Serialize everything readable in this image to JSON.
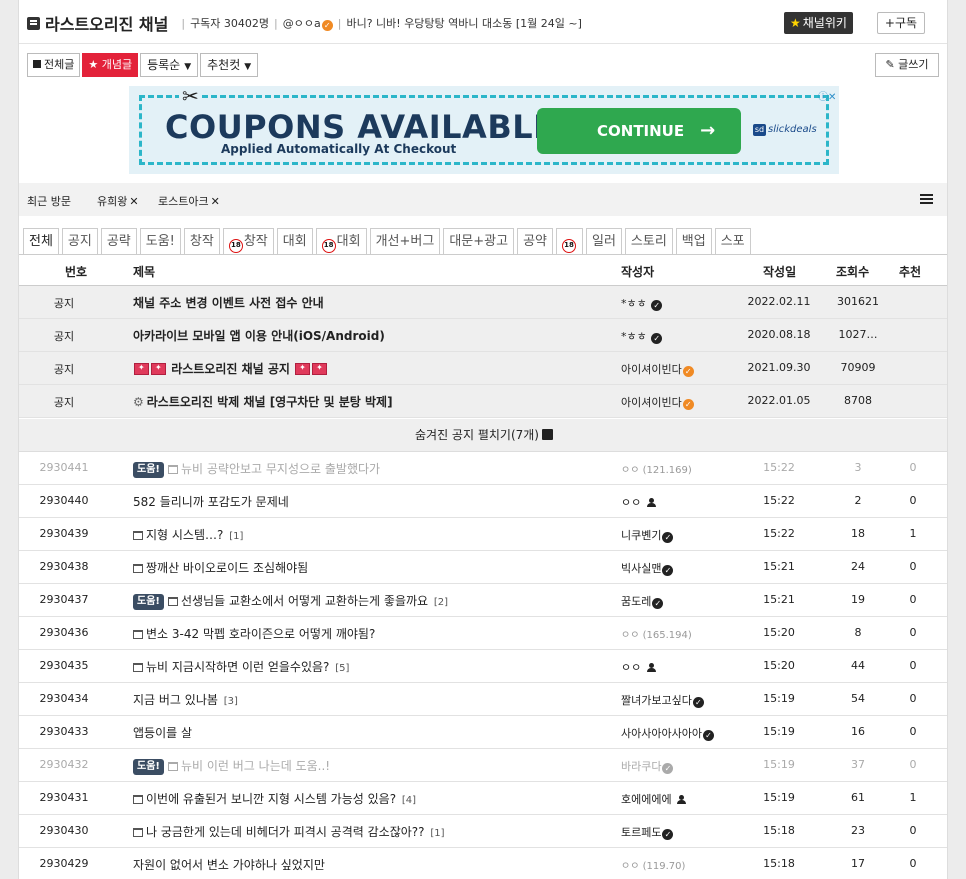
{
  "header": {
    "channel_name": "라스트오리진 채널",
    "subscribers": "구독자 30402명",
    "owner": "@ㅇㅇa",
    "description": "바니? 니바! 우당탕탕 역바니 대소동 [1월 24일 ~]",
    "wiki_label": "채널위키",
    "subscribe_label": "+구독"
  },
  "filters": {
    "all_label": "전체글",
    "best_label": "★ 개념글",
    "sort_label": "등록순",
    "cut_label": "추천컷",
    "write_label": "✎ 글쓰기"
  },
  "ad": {
    "headline": "COUPONS AVAILABLE",
    "subline": "Applied Automatically At Checkout",
    "cta": "CONTINUE",
    "brand": "slickdeals"
  },
  "recent": {
    "label": "최근 방문",
    "items": [
      "유희왕",
      "로스트아크"
    ]
  },
  "categories": [
    "전체",
    "공지",
    "공략",
    "도움!",
    "창작",
    "창작",
    "대회",
    "대회",
    "개선+버그",
    "대문+광고",
    "공약",
    "",
    "일러",
    "스토리",
    "백업",
    "스포"
  ],
  "table": {
    "headers": {
      "num": "번호",
      "title": "제목",
      "author": "작성자",
      "date": "작성일",
      "views": "조회수",
      "rec": "추천"
    },
    "notices": [
      {
        "num": "공지",
        "title": "채널 주소 변경 이벤트 사전 접수 안내",
        "author": "*ㅎㅎ",
        "date": "2022.02.11",
        "views": "301621"
      },
      {
        "num": "공지",
        "title": "아카라이브 모바일 앱 이용 안내(iOS/Android)",
        "author": "*ㅎㅎ",
        "date": "2020.08.18",
        "views": "1027…"
      },
      {
        "num": "공지",
        "title": "라스트오리진 채널 공지",
        "author": "아이셔이빈다",
        "date": "2021.09.30",
        "views": "70909"
      },
      {
        "num": "공지",
        "title": "라스트오리진 박제 채널 [영구차단 및 분탕 박제]",
        "author": "아이셔이빈다",
        "date": "2022.01.05",
        "views": "8708"
      }
    ],
    "unfold_label": "숨겨진 공지 펼치기(7개)",
    "posts": [
      {
        "num": "2930441",
        "badge": "도움!",
        "title": "뉴비 공략안보고 무지성으로 출발했다가",
        "comments": "",
        "author": "ㅇㅇ (121.169)",
        "date": "15:22",
        "views": "3",
        "rec": "0"
      },
      {
        "num": "2930440",
        "badge": "",
        "title": "582 들리니까 포감도가 문제네",
        "comments": "",
        "author": "ㅇㅇ",
        "date": "15:22",
        "views": "2",
        "rec": "0"
      },
      {
        "num": "2930439",
        "badge": "",
        "title": "지형 시스템…?",
        "comments": "[1]",
        "author": "니쿠볜기",
        "date": "15:22",
        "views": "18",
        "rec": "1"
      },
      {
        "num": "2930438",
        "badge": "",
        "title": "짱깨산 바이오로이드 조심해야됨",
        "comments": "",
        "author": "빅사실맨",
        "date": "15:21",
        "views": "24",
        "rec": "0"
      },
      {
        "num": "2930437",
        "badge": "도움!",
        "title": "선생님들 교환소에서 어떻게 교환하는게 좋을까요",
        "comments": "[2]",
        "author": "꿈도레",
        "date": "15:21",
        "views": "19",
        "rec": "0"
      },
      {
        "num": "2930436",
        "badge": "",
        "title": "변소 3-42 막펩 호라이즌으로 어떻게 깨야됨?",
        "comments": "",
        "author": "ㅇㅇ (165.194)",
        "date": "15:20",
        "views": "8",
        "rec": "0"
      },
      {
        "num": "2930435",
        "badge": "",
        "title": "뉴비 지금시작하면 이런 얻을수있음?",
        "comments": "[5]",
        "author": "ㅇㅇ",
        "date": "15:20",
        "views": "44",
        "rec": "0"
      },
      {
        "num": "2930434",
        "badge": "",
        "title": "지금 버그 있나봄",
        "comments": "[3]",
        "author": "짤녀가보고싶다",
        "date": "15:19",
        "views": "54",
        "rec": "0"
      },
      {
        "num": "2930433",
        "badge": "",
        "title": "앱등이를 살",
        "comments": "",
        "author": "사아사아아사아아",
        "date": "15:19",
        "views": "16",
        "rec": "0"
      },
      {
        "num": "2930432",
        "badge": "도움!",
        "title": "뉴비 이런 버그 나는데 도움..!",
        "comments": "",
        "author": "바라쿠다",
        "date": "15:19",
        "views": "37",
        "rec": "0"
      },
      {
        "num": "2930431",
        "badge": "",
        "title": "이번에 유출된거 보니깐 지형 시스템 가능성 있음?",
        "comments": "[4]",
        "author": "호에에에에",
        "date": "15:19",
        "views": "61",
        "rec": "1"
      },
      {
        "num": "2930430",
        "badge": "",
        "title": "나 궁금한게 있는데 비헤더가 피격시 공격력 감소잖아??",
        "comments": "[1]",
        "author": "토르페도",
        "date": "15:18",
        "views": "23",
        "rec": "0"
      },
      {
        "num": "2930429",
        "badge": "",
        "title": "자원이 없어서 변소 가야하나 싶었지만",
        "comments": "",
        "author": "ㅇㅇ (119.70)",
        "date": "15:18",
        "views": "17",
        "rec": "0"
      }
    ]
  },
  "colors": {
    "accent": "#e3223a",
    "ad_cta": "#2fa84f",
    "ad_border": "#2cb6c9",
    "help_badge": "#3b4d63"
  }
}
